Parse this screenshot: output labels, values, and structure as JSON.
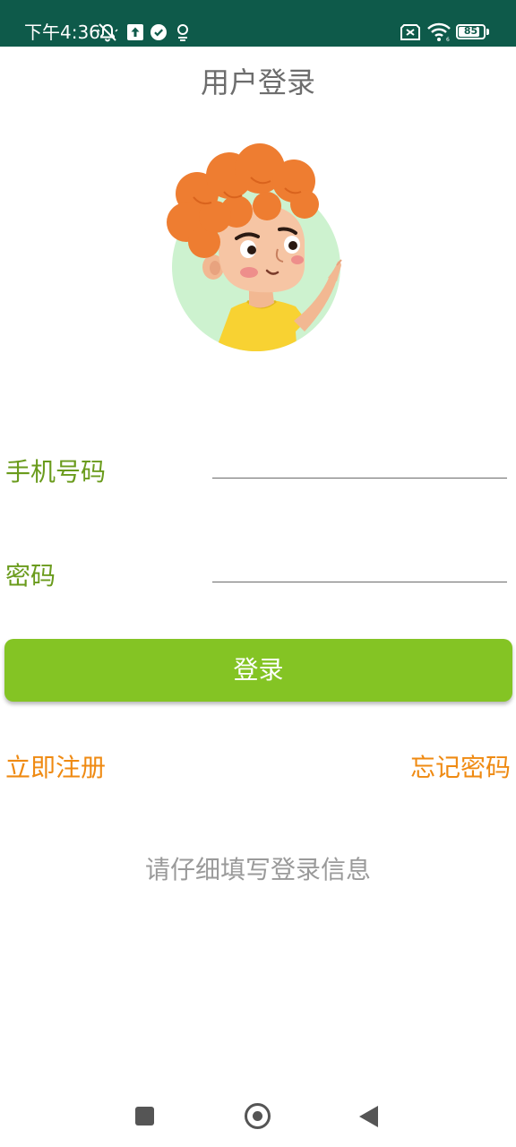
{
  "status_bar": {
    "time": "下午4:36",
    "battery": "85",
    "battery_level": 0.85,
    "icons": [
      "notifications-off-icon",
      "upload-icon",
      "check-circle-icon",
      "location-icon",
      "sim-off-icon",
      "wifi-icon",
      "battery-icon"
    ]
  },
  "page": {
    "title": "用户登录"
  },
  "avatar": {
    "icon": "cartoon-boy-avatar"
  },
  "form": {
    "phone_label": "手机号码",
    "phone_value": "",
    "password_label": "密码",
    "password_value": ""
  },
  "actions": {
    "login_label": "登录",
    "register_label": "立即注册",
    "forgot_label": "忘记密码"
  },
  "hint": "请仔细填写登录信息",
  "nav_bar": {
    "icons": [
      "recent-apps-icon",
      "home-icon",
      "back-icon"
    ]
  },
  "colors": {
    "status_bar": "#0e5a4a",
    "accent_green": "#84c424",
    "label_green": "#6a9b1c",
    "link_orange": "#ef8a12",
    "hint_gray": "#9a9a9a"
  }
}
